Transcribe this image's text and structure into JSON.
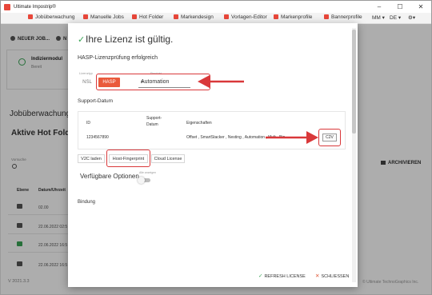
{
  "window": {
    "title": "Ultimate Impostrip®",
    "controls": [
      "–",
      "☐",
      "✕"
    ]
  },
  "menubar": {
    "items": [
      "Jobüberwachung",
      "Manuelle Jobs",
      "Hot Folder",
      "Markendesign",
      "Vorlagen-Editor",
      "Markenprofile",
      "Bannerprofile"
    ],
    "user": "MM ▾",
    "lang": "DE ▾",
    "settings": "⚙▾"
  },
  "subbar": {
    "new_job": "NEUER JOB...",
    "new_2": "N"
  },
  "index_card": {
    "title": "Indiziermodul",
    "status": "Bereit"
  },
  "page": {
    "section_title": "Jobüberwachung",
    "section_sub": "Aktive Hot Folder",
    "search_label": "Vorsuche",
    "archive_btn": "ARCHIVIEREN",
    "col_ebene": "Ebene",
    "col_datum": "Datum/Uhrzeit",
    "rows": [
      "02.00",
      "22.06.2022 02:5",
      "22.06.2022 16:5",
      "22.06.2022 16:5"
    ],
    "version": "V 2021.3.3",
    "footer_right": "© Ultimate TechnoGraphics Inc."
  },
  "modal": {
    "check_icon": "✓",
    "title": "Ihre Lizenz ist gültig.",
    "hasp_msg": "HASP-Lizenzprüfung erfolgreich",
    "license_label": "Lizenztyp",
    "product_label": "Produkt",
    "nsl": "NSL",
    "hasp": "HASP",
    "product_value": "Automation",
    "support_title": "Support-Datum",
    "th_id": "ID",
    "th_support": "Support-Datum",
    "th_props": "Eigenschaften",
    "td_id": "1234567890",
    "td_props": "Offset , SmartStacker , Nesting , Automation , Mult - Bin",
    "c2v": "C2V",
    "tab_v2c": "V2C laden",
    "tab_host": "Host-Fingerprint",
    "tab_cloud": "Cloud License",
    "options_title": "Verfügbare Optionen",
    "toggle_label": "Alle anzeigen",
    "bindung": "Bindung",
    "refresh_btn": "REFRESH LICENSE",
    "close_btn": "SCHLIESSEN"
  },
  "colors": {
    "accent": "#ea5a3c",
    "highlight": "#d9383a",
    "success": "#3aa556"
  }
}
